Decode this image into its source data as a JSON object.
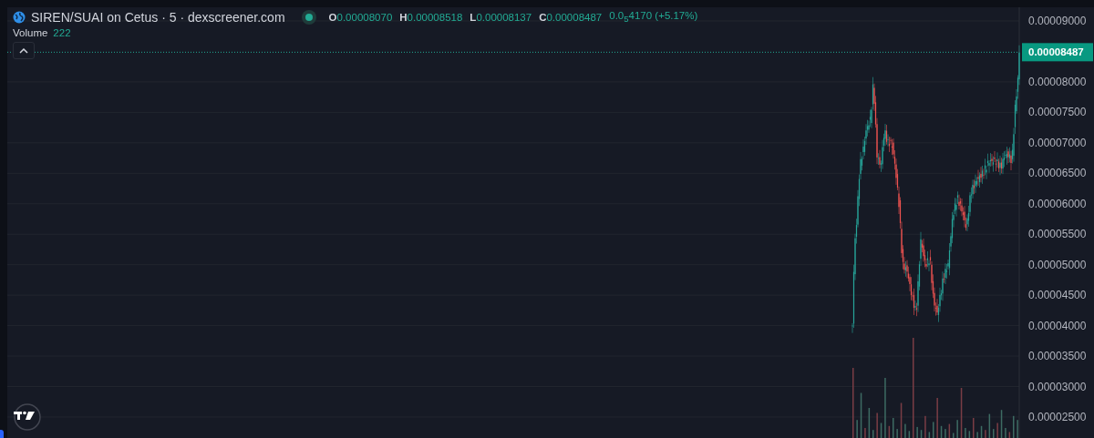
{
  "legend": {
    "title": "SIREN/SUAI on Cetus · 5 · dexscreener.com",
    "market_open": true,
    "ohlc": [
      {
        "key": "O",
        "value": "0.00008070"
      },
      {
        "key": "H",
        "value": "0.00008518"
      },
      {
        "key": "L",
        "value": "0.00008137"
      },
      {
        "key": "C",
        "value": "0.00008487"
      }
    ],
    "change": "0.0$_{5}$4170 (+5.17%)",
    "volume_label": "Volume",
    "volume_value": "222"
  },
  "last_price": "0.00008487",
  "price_axis": [
    "0.00009000",
    "0.00008000",
    "0.00007500",
    "0.00007000",
    "0.00006500",
    "0.00006000",
    "0.00005500",
    "0.00005000",
    "0.00004500",
    "0.00004000",
    "0.00003500",
    "0.00003000",
    "0.00002500"
  ]
}
